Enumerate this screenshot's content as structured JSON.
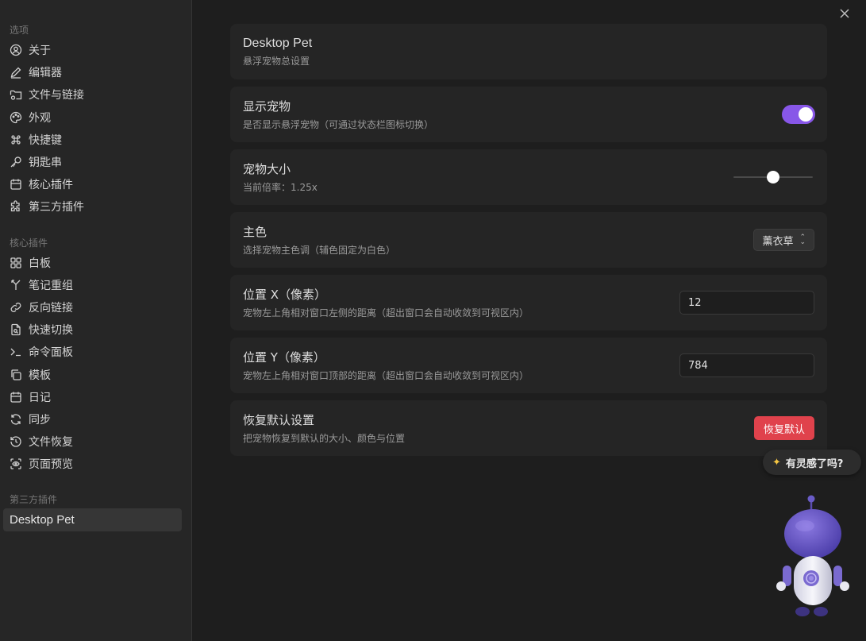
{
  "sidebar": {
    "sections": [
      {
        "header": "选项",
        "items": [
          {
            "label": "关于",
            "icon": "user-circle-icon"
          },
          {
            "label": "编辑器",
            "icon": "pencil-icon"
          },
          {
            "label": "文件与链接",
            "icon": "folder-cog-icon"
          },
          {
            "label": "外观",
            "icon": "palette-icon"
          },
          {
            "label": "快捷键",
            "icon": "command-icon"
          },
          {
            "label": "钥匙串",
            "icon": "key-icon"
          },
          {
            "label": "核心插件",
            "icon": "calendar-plug-icon"
          },
          {
            "label": "第三方插件",
            "icon": "puzzle-icon"
          }
        ]
      },
      {
        "header": "核心插件",
        "items": [
          {
            "label": "白板",
            "icon": "layout-grid-icon"
          },
          {
            "label": "笔记重组",
            "icon": "merge-icon"
          },
          {
            "label": "反向链接",
            "icon": "link-icon"
          },
          {
            "label": "快速切换",
            "icon": "file-search-icon"
          },
          {
            "label": "命令面板",
            "icon": "terminal-icon"
          },
          {
            "label": "模板",
            "icon": "copy-icon"
          },
          {
            "label": "日记",
            "icon": "calendar-icon"
          },
          {
            "label": "同步",
            "icon": "refresh-icon"
          },
          {
            "label": "文件恢复",
            "icon": "history-icon"
          },
          {
            "label": "页面预览",
            "icon": "scan-eye-icon"
          }
        ]
      },
      {
        "header": "第三方插件",
        "items": [
          {
            "label": "Desktop Pet",
            "active": true
          }
        ]
      }
    ]
  },
  "settings": {
    "heading": {
      "title": "Desktop Pet",
      "desc": "悬浮宠物总设置"
    },
    "show_pet": {
      "title": "显示宠物",
      "desc": "是否显示悬浮宠物（可通过状态栏图标切换）",
      "enabled": true
    },
    "pet_size": {
      "title": "宠物大小",
      "desc": "当前倍率：1.25x",
      "slider_fraction": 0.5
    },
    "main_color": {
      "title": "主色",
      "desc": "选择宠物主色调（辅色固定为白色）",
      "selected": "薰衣草"
    },
    "pos_x": {
      "title": "位置 X（像素）",
      "desc": "宠物左上角相对窗口左侧的距离（超出窗口会自动收敛到可视区内）",
      "value": "12"
    },
    "pos_y": {
      "title": "位置 Y（像素）",
      "desc": "宠物左上角相对窗口顶部的距离（超出窗口会自动收敛到可视区内）",
      "value": "784"
    },
    "reset": {
      "title": "恢复默认设置",
      "desc": "把宠物恢复到默认的大小、颜色与位置",
      "button": "恢复默认"
    }
  },
  "pet": {
    "bubble": "有灵感了吗?",
    "accent": "#8857e8",
    "danger": "#e0424c"
  }
}
